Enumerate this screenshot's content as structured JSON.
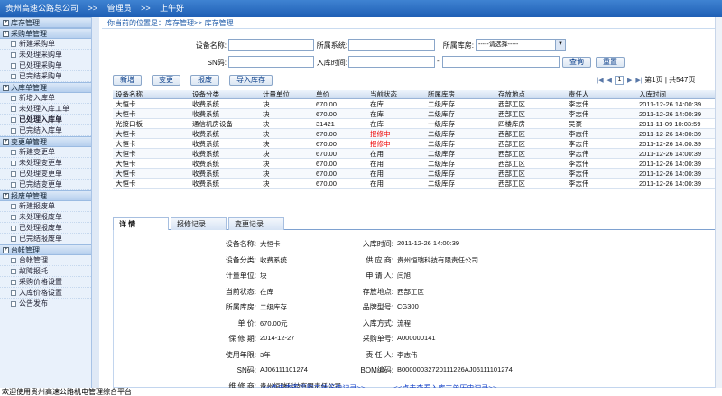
{
  "header": {
    "company": "贵州高速公路总公司",
    "sep1": ">>",
    "role": "管理员",
    "sep2": ">>",
    "greeting": "上午好"
  },
  "sidebar": {
    "groups": [
      {
        "title": "库存管理",
        "items": []
      },
      {
        "title": "采购单管理",
        "items": [
          "新建采购单",
          "未处理采购单",
          "已处理采购单",
          "已完结采购单"
        ]
      },
      {
        "title": "入库单管理",
        "items": [
          "新增入库单",
          "未处理入库工单",
          "已处理入库单",
          "已完结入库单"
        ]
      },
      {
        "title": "变更单管理",
        "items": [
          "新建变更单",
          "未处理变更单",
          "已处理变更单",
          "已完结变更单"
        ]
      },
      {
        "title": "报废单管理",
        "items": [
          "新建报废单",
          "未处理报废单",
          "已处理报废单",
          "已完结报废单"
        ]
      },
      {
        "title": "台帐管理",
        "items": [
          "台帐管理",
          "故障报托",
          "采购价格设置",
          "入库价格设置",
          "公告发布"
        ]
      }
    ]
  },
  "breadcrumb": "你当前的位置是：库存管理>> 库存管理",
  "filters": {
    "device_name_label": "设备名称:",
    "system_label": "所属系统:",
    "warehouse_label": "所属库房:",
    "warehouse_value": "-----请选择-----",
    "sn_label": "SN码:",
    "time_label": "入库时间:",
    "dash": "-",
    "query": "查询",
    "reset": "重置"
  },
  "toolbar": {
    "add": "新增",
    "change": "变更",
    "scrap": "报废",
    "import": "导入库存"
  },
  "pager": {
    "first": "|◀",
    "prev": "◀",
    "next": "▶",
    "last": "▶|",
    "page": "1",
    "text": "第1页 | 共547页"
  },
  "table": {
    "headers": [
      "设备名称",
      "设备分类",
      "计量单位",
      "单价",
      "当前状态",
      "所属库房",
      "存放地点",
      "责任人",
      "入库时间"
    ],
    "rows": [
      [
        "大恒卡",
        "收费系统",
        "块",
        "670.00",
        "在库",
        "二级库存",
        "西部工区",
        "李志伟",
        "2011-12-26 14:00:39"
      ],
      [
        "大恒卡",
        "收费系统",
        "块",
        "670.00",
        "在库",
        "二级库存",
        "西部工区",
        "李志伟",
        "2011-12-26 14:00:39"
      ],
      [
        "光接口板",
        "通信机房设备",
        "块",
        "31421",
        "在库",
        "一级库存",
        "四楼库房",
        "吴豪",
        "2011-11-09 10:03:59"
      ],
      [
        "大恒卡",
        "收费系统",
        "块",
        "670.00",
        "报修中",
        "二级库存",
        "西部工区",
        "李志伟",
        "2011-12-26 14:00:39"
      ],
      [
        "大恒卡",
        "收费系统",
        "块",
        "670.00",
        "报修中",
        "二级库存",
        "西部工区",
        "李志伟",
        "2011-12-26 14:00:39"
      ],
      [
        "大恒卡",
        "收费系统",
        "块",
        "670.00",
        "在用",
        "二级库存",
        "西部工区",
        "李志伟",
        "2011-12-26 14:00:39"
      ],
      [
        "大恒卡",
        "收费系统",
        "块",
        "670.00",
        "在用",
        "二级库存",
        "西部工区",
        "李志伟",
        "2011-12-26 14:00:39"
      ],
      [
        "大恒卡",
        "收费系统",
        "块",
        "670.00",
        "在用",
        "二级库存",
        "西部工区",
        "李志伟",
        "2011-12-26 14:00:39"
      ],
      [
        "大恒卡",
        "收费系统",
        "块",
        "670.00",
        "在用",
        "二级库存",
        "西部工区",
        "李志伟",
        "2011-12-26 14:00:39"
      ]
    ]
  },
  "tabs": [
    "详 情",
    "报修记录",
    "变更记录"
  ],
  "detail": {
    "left": [
      [
        "设备名称:",
        "大恒卡"
      ],
      [
        "设备分类:",
        "收费系统"
      ],
      [
        "计量单位:",
        "块"
      ],
      [
        "当前状态:",
        "在库"
      ],
      [
        "所属库房:",
        "二级库存"
      ],
      [
        "单  价:",
        "670.00元"
      ],
      [
        "保 修 期:",
        "2014-12-27"
      ],
      [
        "使用年限:",
        "3年"
      ],
      [
        "SN码:",
        "AJ06111101274"
      ],
      [
        "维 修 商:",
        "贵州恒瑞科技有限责任公司"
      ]
    ],
    "right": [
      [
        "入库时间:",
        "2011-12-26 14:00:39"
      ],
      [
        "供 应 商:",
        "贵州恒瑞科技有限责任公司"
      ],
      [
        "申 请 人:",
        "闫旭"
      ],
      [
        "存放地点:",
        "西部工区"
      ],
      [
        "品牌型号:",
        "CG300"
      ],
      [
        "入库方式:",
        "流程"
      ],
      [
        "采购单号:",
        "A000000141"
      ],
      [
        "责 任 人:",
        "李志伟"
      ],
      [
        "BOM编码:",
        "B00000032720111226AJ06111101274"
      ]
    ],
    "link_left": "<<点击查看采购工单历史记录>>",
    "link_right": "<<点击查看入库工单历史记录>>"
  },
  "status": "欢迎使用贵州高速公路机电管理综合平台"
}
